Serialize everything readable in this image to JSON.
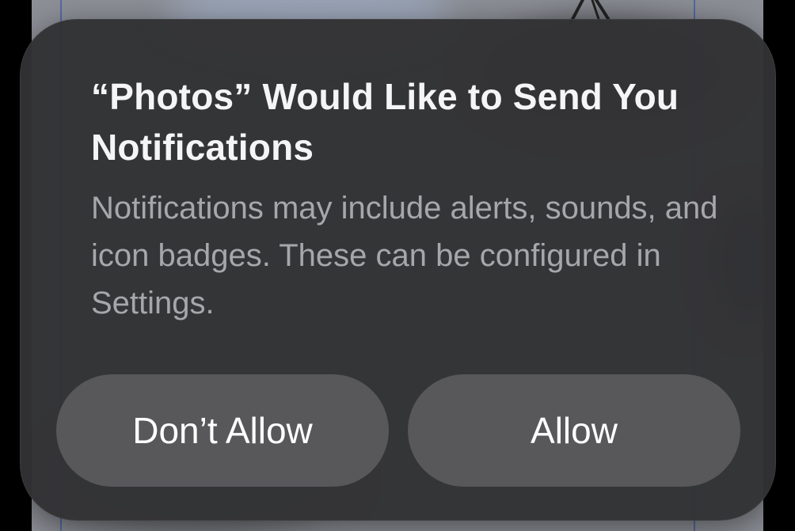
{
  "alert": {
    "title": "“Photos” Would Like to Send You Notifications",
    "message": "Notifications may include alerts, sounds, and icon badges. These can be configured in Settings.",
    "dont_allow_label": "Don’t Allow",
    "allow_label": "Allow"
  }
}
